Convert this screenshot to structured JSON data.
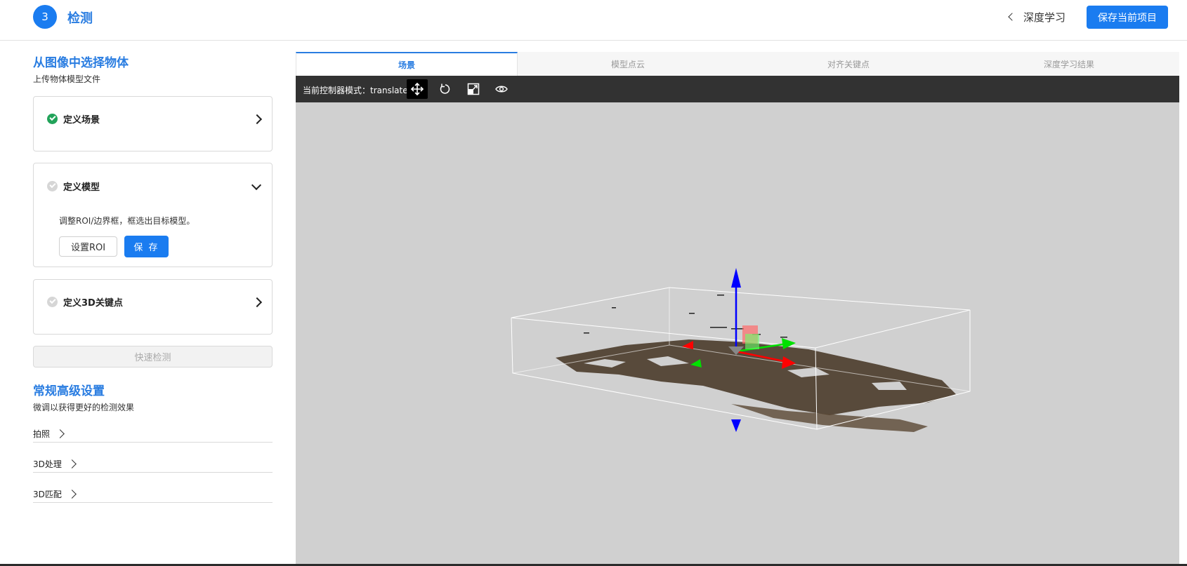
{
  "header": {
    "step_number": "3",
    "step_title": "检测",
    "back_label": "深度学习",
    "save_project_label": "保存当前项目"
  },
  "left": {
    "section1_title": "从图像中选择物体",
    "section1_subtitle": "上传物体模型文件",
    "cards": [
      {
        "title": "定义场景",
        "status": "done",
        "expanded": false
      },
      {
        "title": "定义模型",
        "status": "pending",
        "expanded": true,
        "description": "调整ROI/边界框，框选出目标模型。",
        "roi_button": "设置ROI",
        "save_button": "保 存"
      },
      {
        "title": "定义3D关键点",
        "status": "pending",
        "expanded": false
      }
    ],
    "quick_detect_label": "快速检测",
    "section2_title": "常规高级设置",
    "section2_subtitle": "微调以获得更好的检测效果",
    "advanced_items": [
      "拍照",
      "3D处理",
      "3D匹配"
    ]
  },
  "viewer": {
    "tabs": [
      "场景",
      "模型点云",
      "对齐关键点",
      "深度学习结果"
    ],
    "active_tab": 0,
    "mode_label": "当前控制器模式：translate",
    "tools": [
      "move-icon",
      "rotate-icon",
      "scale-icon",
      "eye-icon"
    ],
    "active_tool": 0
  },
  "colors": {
    "primary": "#1a7cf0",
    "title_blue": "#2a7de1",
    "success": "#22a35a",
    "toolbar_bg": "#323232",
    "viewport_bg": "#d0d0d0"
  }
}
